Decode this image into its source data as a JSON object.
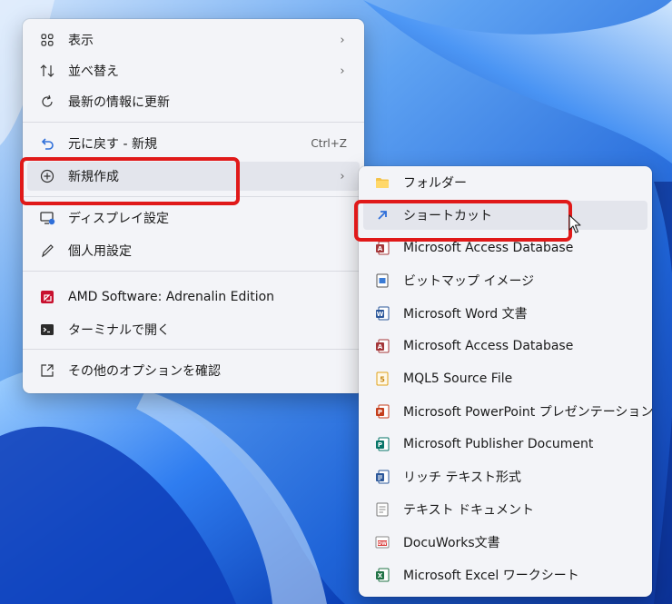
{
  "main_menu": {
    "items": [
      {
        "label": "表示",
        "icon": "grid-icon",
        "submenu": true
      },
      {
        "label": "並べ替え",
        "icon": "sort-icon",
        "submenu": true
      },
      {
        "label": "最新の情報に更新",
        "icon": "refresh-icon"
      },
      {
        "label": "元に戻す - 新規",
        "icon": "undo-icon",
        "shortcut": "Ctrl+Z"
      },
      {
        "label": "新規作成",
        "icon": "plus-circle-icon",
        "submenu": true
      },
      {
        "label": "ディスプレイ設定",
        "icon": "display-icon"
      },
      {
        "label": "個人用設定",
        "icon": "pen-icon"
      },
      {
        "label": "AMD Software: Adrenalin Edition",
        "icon": "amd-icon"
      },
      {
        "label": "ターミナルで開く",
        "icon": "terminal-icon"
      },
      {
        "label": "その他のオプションを確認",
        "icon": "external-icon"
      }
    ]
  },
  "sub_menu": {
    "items": [
      {
        "label": "フォルダー",
        "icon": "folder-icon"
      },
      {
        "label": "ショートカット",
        "icon": "shortcut-icon"
      },
      {
        "label": "Microsoft Access Database",
        "icon": "access-icon"
      },
      {
        "label": "ビットマップ イメージ",
        "icon": "bitmap-icon"
      },
      {
        "label": "Microsoft Word 文書",
        "icon": "word-icon"
      },
      {
        "label": "Microsoft Access Database",
        "icon": "access-icon"
      },
      {
        "label": "MQL5 Source File",
        "icon": "mql5-icon"
      },
      {
        "label": "Microsoft PowerPoint プレゼンテーション",
        "icon": "powerpoint-icon"
      },
      {
        "label": "Microsoft Publisher Document",
        "icon": "publisher-icon"
      },
      {
        "label": "リッチ テキスト形式",
        "icon": "rtf-icon"
      },
      {
        "label": "テキスト ドキュメント",
        "icon": "text-doc-icon"
      },
      {
        "label": "DocuWorks文書",
        "icon": "docuworks-icon"
      },
      {
        "label": "Microsoft Excel ワークシート",
        "icon": "excel-icon"
      }
    ]
  },
  "colors": {
    "highlight": "#e01919",
    "menu_bg": "#f3f4f8",
    "wallpaper": "#2a78e8"
  }
}
